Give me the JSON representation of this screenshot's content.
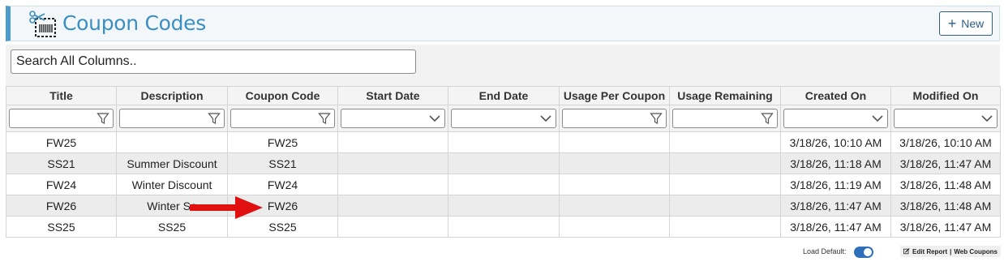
{
  "header": {
    "title": "Coupon Codes",
    "new_label": "New"
  },
  "search": {
    "placeholder": "Search All Columns.."
  },
  "table": {
    "columns": [
      "Title",
      "Description",
      "Coupon Code",
      "Start Date",
      "End Date",
      "Usage Per Coupon",
      "Usage Remaining",
      "Created On",
      "Modified On"
    ],
    "filter_types": [
      "text",
      "text",
      "text",
      "dropdown",
      "dropdown",
      "text",
      "text",
      "dropdown",
      "dropdown"
    ],
    "rows": [
      [
        "FW25",
        "",
        "FW25",
        "",
        "",
        "",
        "",
        "3/18/26, 10:10 AM",
        "3/18/26, 10:10 AM"
      ],
      [
        "SS21",
        "Summer Discount",
        "SS21",
        "",
        "",
        "",
        "",
        "3/18/26, 11:18 AM",
        "3/18/26, 11:47 AM"
      ],
      [
        "FW24",
        "Winter Discount",
        "FW24",
        "",
        "",
        "",
        "",
        "3/18/26, 11:19 AM",
        "3/18/26, 11:48 AM"
      ],
      [
        "FW26",
        "Winter Sa",
        "FW26",
        "",
        "",
        "",
        "",
        "3/18/26, 11:47 AM",
        "3/18/26, 11:48 AM"
      ],
      [
        "SS25",
        "SS25",
        "SS25",
        "",
        "",
        "",
        "",
        "3/18/26, 11:47 AM",
        "3/18/26, 11:47 AM"
      ]
    ]
  },
  "footer": {
    "load_default_label": "Load Default:",
    "load_default_on": true,
    "edit_report_label": "Edit Report",
    "separator": "|",
    "web_coupons_label": "Web Coupons"
  },
  "colors": {
    "accent": "#4a9ccb",
    "title": "#3b8fc2",
    "annotation_arrow": "#e01010",
    "toggle_on": "#2e6fb9"
  },
  "icons": {
    "logo": "scissors-coupon-icon",
    "filter": "funnel-icon",
    "dropdown": "chevron-down-icon",
    "new": "plus-icon",
    "edit": "edit-icon"
  }
}
